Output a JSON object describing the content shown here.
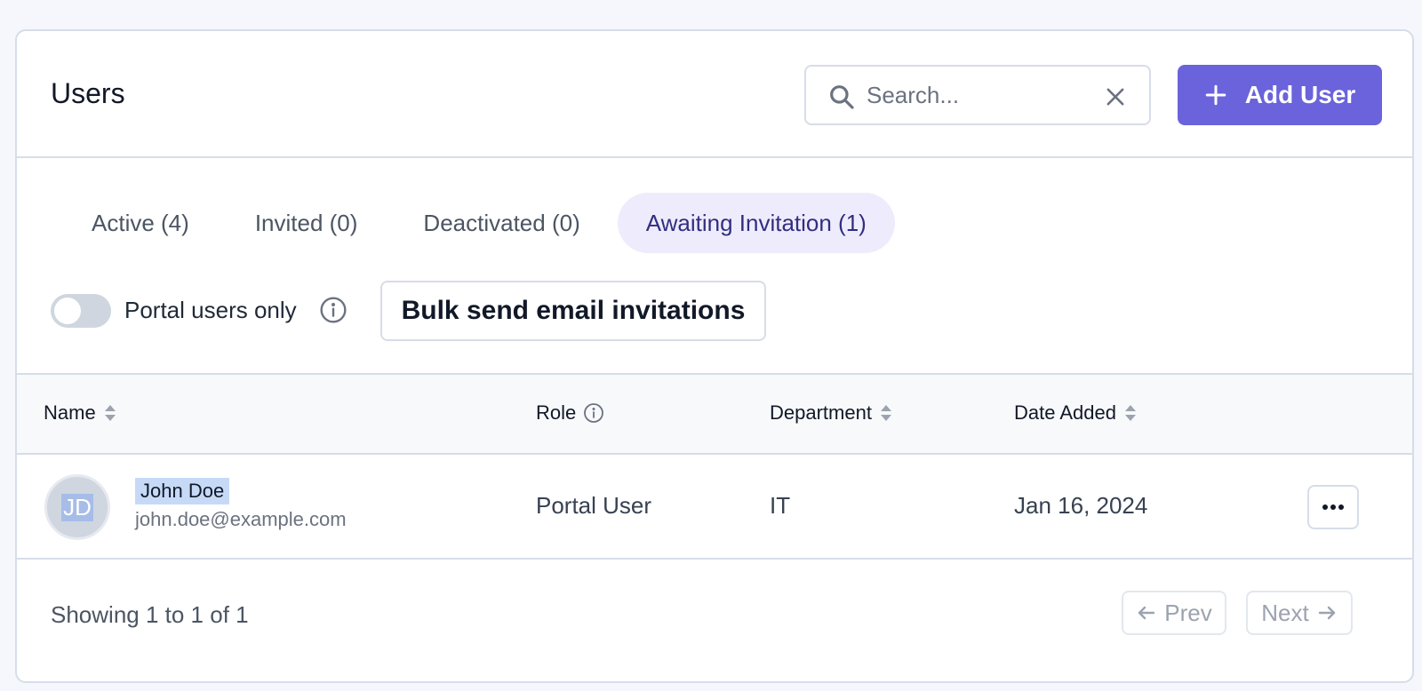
{
  "header": {
    "title": "Users",
    "search_placeholder": "Search...",
    "add_user_label": "Add User"
  },
  "tabs": [
    {
      "label": "Active (4)",
      "active": false
    },
    {
      "label": "Invited (0)",
      "active": false
    },
    {
      "label": "Deactivated (0)",
      "active": false
    },
    {
      "label": "Awaiting Invitation (1)",
      "active": true
    }
  ],
  "toolbar": {
    "toggle_label": "Portal users only",
    "toggle_on": false,
    "bulk_button_label": "Bulk send email invitations"
  },
  "table": {
    "columns": [
      "Name",
      "Role",
      "Department",
      "Date Added"
    ],
    "rows": [
      {
        "initials": "JD",
        "name": "John Doe",
        "email": "john.doe@example.com",
        "role": "Portal User",
        "department": "IT",
        "date_added": "Jan 16, 2024"
      }
    ]
  },
  "footer": {
    "showing_text": "Showing 1 to 1 of 1",
    "prev_label": "Prev",
    "next_label": "Next"
  },
  "colors": {
    "accent": "#6a63dc",
    "active_tab_bg": "#eeecfc",
    "active_tab_text": "#312e81",
    "border": "#d7dde8"
  }
}
